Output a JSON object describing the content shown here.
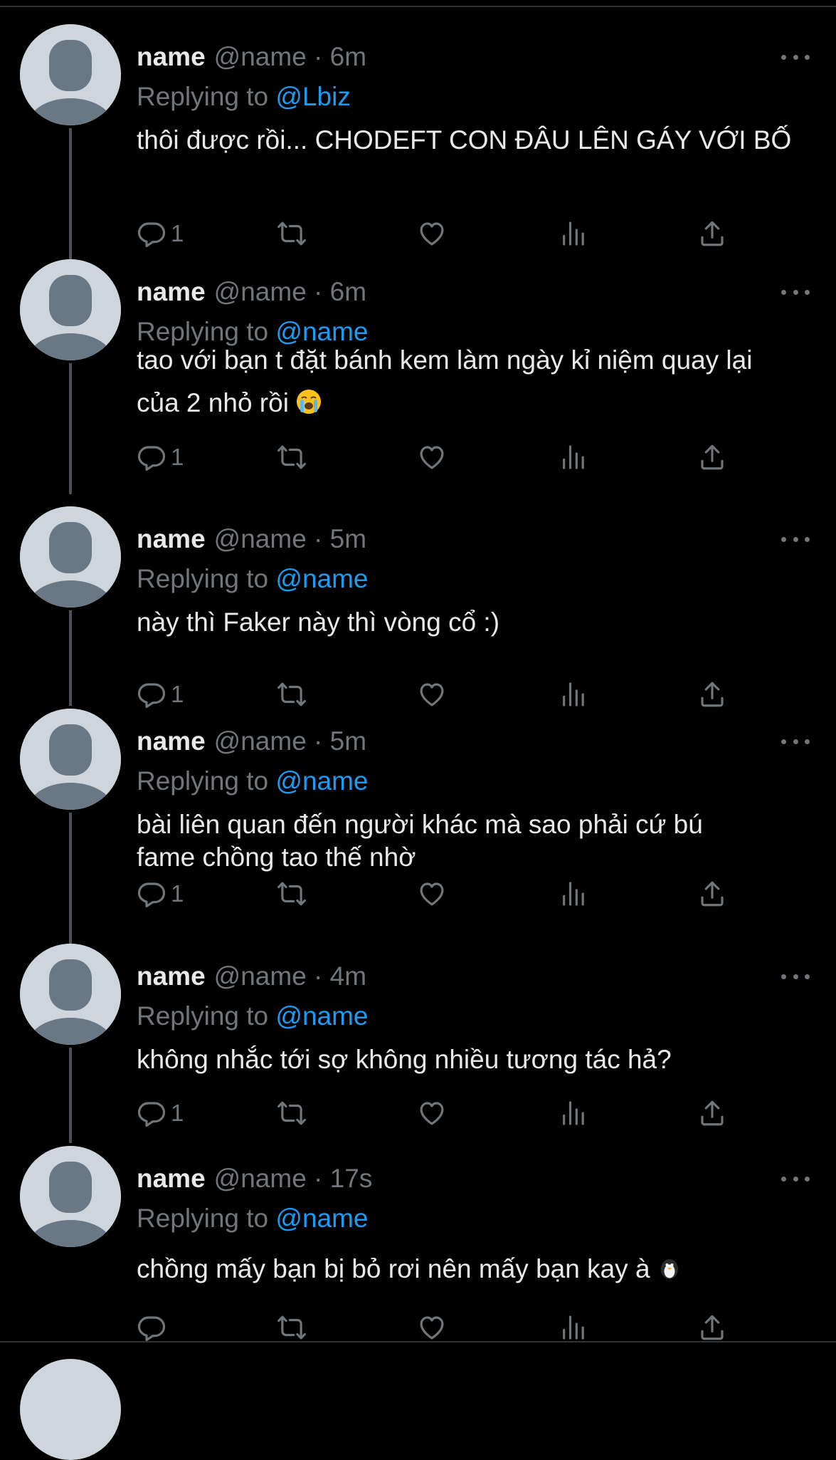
{
  "colors": {
    "background": "#000000",
    "text": "#e7e9ea",
    "muted": "#71767b",
    "accent": "#1d9bf0",
    "avatar_bg": "#ced5dc",
    "avatar_fg": "#6a7886"
  },
  "tweets": [
    {
      "name": "name",
      "handle": "@name",
      "time": "6m",
      "replying_prefix": "Replying to",
      "replying_to": "@Lbiz",
      "text": "thôi được rồi... CHODEFT CON ĐÂU LÊN GÁY VỚI BỐ",
      "reply_count": "1"
    },
    {
      "name": "name",
      "handle": "@name",
      "time": "6m",
      "replying_prefix": "Replying to",
      "replying_to": "@name",
      "text": "tao với bạn t đặt bánh kem làm ngày kỉ niệm quay lại\ncủa 2 nhỏ rồi",
      "emoji": "crying-face-emoji",
      "reply_count": "1"
    },
    {
      "name": "name",
      "handle": "@name",
      "time": "5m",
      "replying_prefix": "Replying to",
      "replying_to": "@name",
      "text": "này thì Faker này thì vòng cổ :)",
      "reply_count": "1"
    },
    {
      "name": "name",
      "handle": "@name",
      "time": "5m",
      "replying_prefix": "Replying to",
      "replying_to": "@name",
      "text": "bài liên quan đến người khác mà sao phải cứ bú\nfame chồng tao thế nhờ",
      "reply_count": "1"
    },
    {
      "name": "name",
      "handle": "@name",
      "time": "4m",
      "replying_prefix": "Replying to",
      "replying_to": "@name",
      "text": "không nhắc tới sợ không nhiều tương tác hả?",
      "reply_count": "1"
    },
    {
      "name": "name",
      "handle": "@name",
      "time": "17s",
      "replying_prefix": "Replying to",
      "replying_to": "@name",
      "text": "chồng mấy bạn bị bỏ rơi nên mấy bạn kay à",
      "emoji": "penguin-emoji",
      "reply_count": ""
    }
  ],
  "icons": {
    "reply": "speech-bubble-icon",
    "retweet": "retweet-icon",
    "like": "heart-icon",
    "views": "bar-chart-icon",
    "share": "share-upload-icon",
    "more": "ellipsis-icon"
  }
}
